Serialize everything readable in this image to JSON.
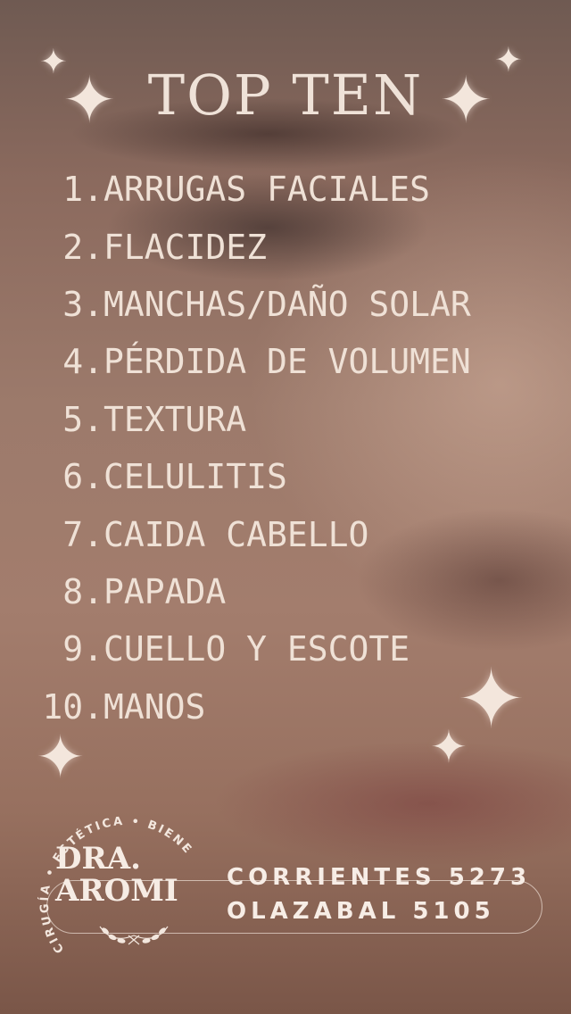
{
  "title": "TOP TEN",
  "items": [
    {
      "num": "1.",
      "text": "ARRUGAS FACIALES"
    },
    {
      "num": "2.",
      "text": "FLACIDEZ"
    },
    {
      "num": "3.",
      "text": "MANCHAS/DAÑO SOLAR"
    },
    {
      "num": "4.",
      "text": "PÉRDIDA DE VOLUMEN"
    },
    {
      "num": "5.",
      "text": "TEXTURA"
    },
    {
      "num": "6.",
      "text": "CELULITIS"
    },
    {
      "num": "7.",
      "text": "CAIDA CABELLO"
    },
    {
      "num": "8.",
      "text": "PAPADA"
    },
    {
      "num": "9.",
      "text": "CUELLO Y ESCOTE"
    },
    {
      "num": "10.",
      "text": "MANOS"
    }
  ],
  "logo": {
    "name_line1": "DRA.",
    "name_line2": "AROMI",
    "ring_text": "CIRUGÍA • ESTÉTICA • BIENESTAR"
  },
  "addresses": {
    "line1": "CORRIENTES 5273",
    "line2": "OLAZABAL 5105"
  },
  "colors": {
    "text": "#efe1d6",
    "background": "#9c7a6b"
  },
  "icons": [
    "sparkle-icon",
    "laurel-icon"
  ]
}
